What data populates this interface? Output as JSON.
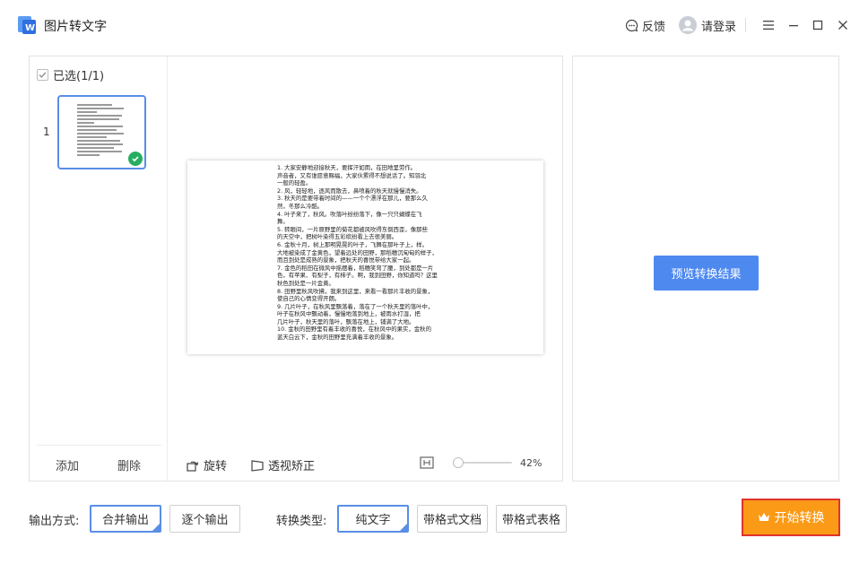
{
  "app": {
    "title": "图片转文字"
  },
  "header": {
    "feedback_label": "反馈",
    "login_label": "请登录"
  },
  "thumbnails": {
    "select_all_label": "已选(1/1)",
    "items": [
      {
        "index": "1",
        "selected": true
      }
    ],
    "add_label": "添加",
    "delete_label": "删除"
  },
  "toolbar": {
    "rotate_label": "旋转",
    "perspective_label": "透视矫正",
    "zoom_value": "42%",
    "zoom_fraction": 0.0
  },
  "document_lines": [
    "1. 大家安静地迎接秋天，要挥汗如雨，在田地里劳作。",
    "声音者，又有谁愿意赐福，大家伙累得不想说话了。知羽北",
    "一般的轻盈。",
    "2. 风，轻轻地，逐风而散去，鼻喷着的秋天就慢慢消失。",
    "3. 秋天的是要带着时间的——一个个漂浮在那儿，要那么久",
    "然，冬那么冷酷。",
    "4. 叶子来了，秋风。吹落叶纷纷落下，像一只只蝴蝶在飞",
    "舞。",
    "5. 转眼间，一片原野里的菊花都被风吹得东倒西歪，像那些",
    "的天空中，把树叶染得五彩缤纷看上去很美丽。",
    "6. 金秋十月，树上那明晃晃的叶子，飞舞在那叶子上，样。",
    "大地被染成了金黄色，望着远处的田野，那稻穗沉甸甸的样子，",
    "而且到处是成熟的景象，把秋天的喜悦带给大家一起。",
    "7. 金色的稻田在微风中摇摆着，稻穗笑弯了腰，到处都是一片",
    "色，有苹果、有梨子，有柿子。啊，我到田野，你知道吗？这里",
    "秋色到处是一片金黄。",
    "8. 田野里秋风吹拂，我来到这里，来看一看那片丰收的景象，",
    "使自己的心情变得开朗。",
    "9. 几片叶子，在秋风里飘落着，落在了一个秋天里的落叶中，",
    "叶子在秋风中飘动着，慢慢地落到地上，被雨水打湿，把",
    "几片叶子，秋天里的落叶，飘落在地上，铺满了大地。",
    "10. 金秋的田野里有着丰收的喜悦，在秋风中的果实，金秋的",
    "蓝天白云下，金秋的田野里充满着丰收的景象。"
  ],
  "preview": {
    "button_label": "预览转换结果"
  },
  "bottom": {
    "output_mode_label": "输出方式:",
    "output_modes": [
      "合并输出",
      "逐个输出"
    ],
    "output_mode_selected": "合并输出",
    "convert_type_label": "转换类型:",
    "convert_types": [
      "纯文字",
      "带格式文档",
      "带格式表格"
    ],
    "convert_type_selected": "纯文字",
    "start_label": "开始转换"
  },
  "colors": {
    "accent_blue": "#4e89f0",
    "selected_border": "#5a8ee6",
    "start_orange": "#fb9a17",
    "start_border_red": "#e0332c",
    "check_green": "#27ae60"
  }
}
